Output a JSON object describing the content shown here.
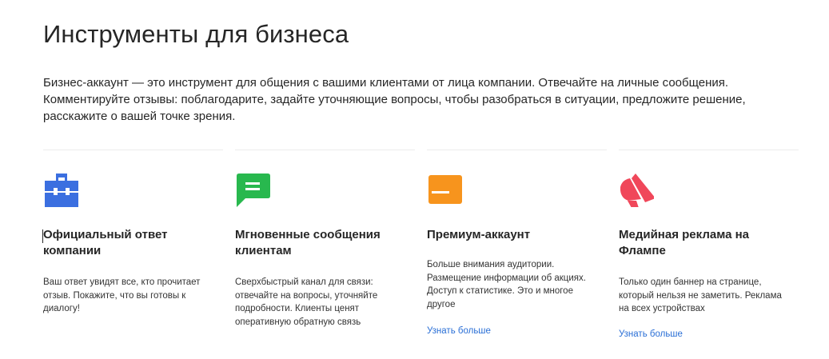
{
  "page": {
    "title": "Инструменты для бизнеса",
    "intro": "Бизнес-аккаунт — это инструмент для общения с вашими клиентами от лица компании. Отвечайте на личные сообщения. Комментируйте отзывы: поблагодарите, задайте уточняющие вопросы, чтобы разобраться в ситуации, предложите решение, расскажите о вашей точке зрения."
  },
  "features": [
    {
      "icon": "briefcase-icon",
      "color": "#3b6fe0",
      "title": "Официальный ответ компании",
      "text": "Ваш ответ увидят все, кто прочитает отзыв. Покажите, что вы готовы к диалогу!"
    },
    {
      "icon": "chat-bubble-icon",
      "color": "#28b84e",
      "title": "Мгновенные сообщения клиентам",
      "text": "Сверхбыстрый канал для связи: отвечайте на вопросы, уточняйте подробности. Клиенты ценят оперативную обратную связь"
    },
    {
      "icon": "card-icon",
      "color": "#f7941d",
      "title": "Премиум-аккаунт",
      "text": "Больше внимания аудитории. Размещение информации об акциях. Доступ к статистике. Это и многое другое",
      "link": "Узнать больше"
    },
    {
      "icon": "megaphone-icon",
      "color": "#f0475a",
      "title": "Медийная реклама на Флампе",
      "text": "Только один баннер на странице, который нельзя не заметить. Реклама на всех устройствах",
      "link": "Узнать больше"
    }
  ]
}
